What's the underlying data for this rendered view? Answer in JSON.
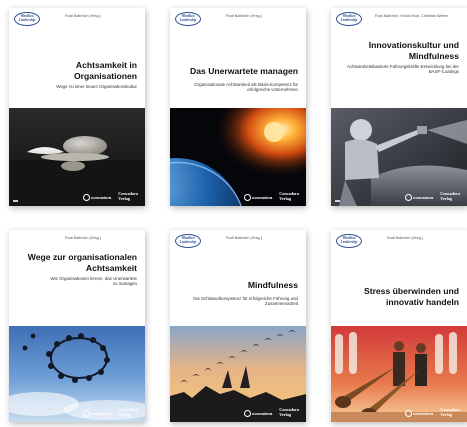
{
  "books": [
    {
      "badge": "Windlust Leadership",
      "editor": "Rudi Ballreich (Hrsg.)",
      "title": "Achtsamkeit in Organisationen",
      "subtitle": "Wege zu einer neuen Organisationskultur",
      "image": "zen-stones-with-feather",
      "publisher_1": "concadora",
      "publisher_2": "Concadora Verlag"
    },
    {
      "badge": "Windlust Leadership",
      "editor": "Rudi Ballreich (Hrsg.)",
      "title": "Das Unerwartete managen",
      "subtitle": "Organisationale Achtsamkeit als Basis-kompetenz für erfolgreiche Unternehmen",
      "image": "planet-with-fiery-meteor",
      "publisher_1": "concadora",
      "publisher_2": "Concadora Verlag"
    },
    {
      "badge": "Windlust Leadership",
      "editor": "Rudi Ballreich, Kristin Bub, Christian Weber",
      "title": "Innovationskultur und Mindfulness",
      "subtitle": "Achtsamkeitsbasierte Führungskräfte-Entwicklung bei der BASF-Coatings",
      "image": "worker-spray-painting",
      "publisher_1": "concadora",
      "publisher_2": "Concadora Verlag"
    },
    {
      "badge": "Windlust Leadership",
      "editor": "Rudi Ballreich (Hrsg.)",
      "title": "Wege zur organisationalen Achtsamkeit",
      "subtitle": "Wie Organisationen lernen, das Unerwartete zu managen",
      "image": "skydivers-circle-formation",
      "publisher_1": "concadora",
      "publisher_2": "Concadora Verlag"
    },
    {
      "badge": "Windlust Leadership",
      "editor": "Rudi Ballreich (Hrsg.)",
      "title": "Mindfulness",
      "subtitle": "Die Schlüsselkompetenz für erfolgreiche Führung und Zusammenarbeit",
      "image": "birds-flying-at-sunset",
      "publisher_1": "concadora",
      "publisher_2": "Concadora Verlag"
    },
    {
      "badge": "Windlust Leadership",
      "editor": "Rudi Ballreich (Hrsg.)",
      "title": "Stress überwinden und innovativ handeln",
      "subtitle": "",
      "image": "alphorn-players-on-stage",
      "publisher_1": "concadora",
      "publisher_2": "Concadora Verlag"
    }
  ]
}
